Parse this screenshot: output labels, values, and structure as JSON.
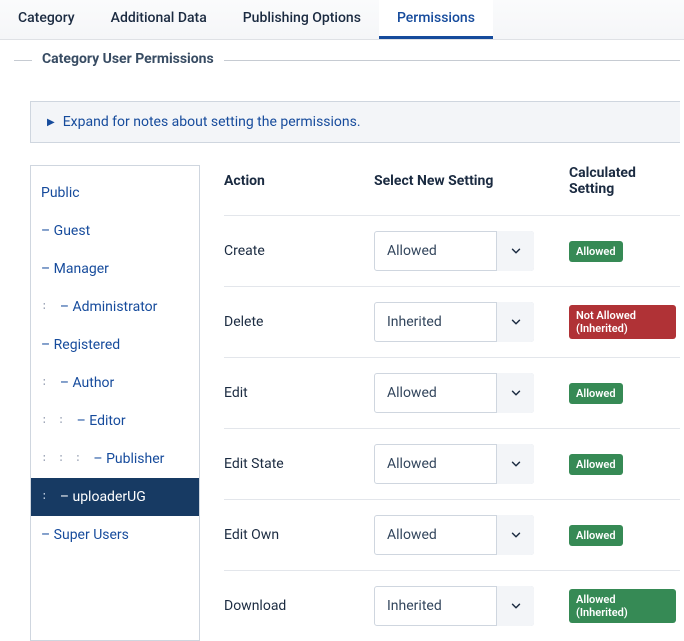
{
  "tabs": {
    "category": "Category",
    "additional_data": "Additional Data",
    "publishing_options": "Publishing Options",
    "permissions": "Permissions"
  },
  "fieldset_title": "Category User Permissions",
  "notes_text": "Expand for notes about setting the permissions.",
  "groups": {
    "public": "Public",
    "guest": "– Guest",
    "manager": "– Manager",
    "administrator": "– Administrator",
    "registered": "– Registered",
    "author": "– Author",
    "editor": "– Editor",
    "publisher": "– Publisher",
    "uploaderug": "– uploaderUG",
    "superusers": "– Super Users"
  },
  "headers": {
    "action": "Action",
    "select": "Select New Setting",
    "calculated": "Calculated Setting"
  },
  "rows": {
    "create": {
      "action": "Create",
      "setting": "Allowed",
      "calc": "Allowed",
      "calc_color": "green"
    },
    "delete": {
      "action": "Delete",
      "setting": "Inherited",
      "calc": "Not Allowed (Inherited)",
      "calc_color": "red"
    },
    "edit": {
      "action": "Edit",
      "setting": "Allowed",
      "calc": "Allowed",
      "calc_color": "green"
    },
    "edit_state": {
      "action": "Edit State",
      "setting": "Allowed",
      "calc": "Allowed",
      "calc_color": "green"
    },
    "edit_own": {
      "action": "Edit Own",
      "setting": "Allowed",
      "calc": "Allowed",
      "calc_color": "green"
    },
    "download": {
      "action": "Download",
      "setting": "Inherited",
      "calc": "Allowed (Inherited)",
      "calc_color": "green"
    }
  }
}
